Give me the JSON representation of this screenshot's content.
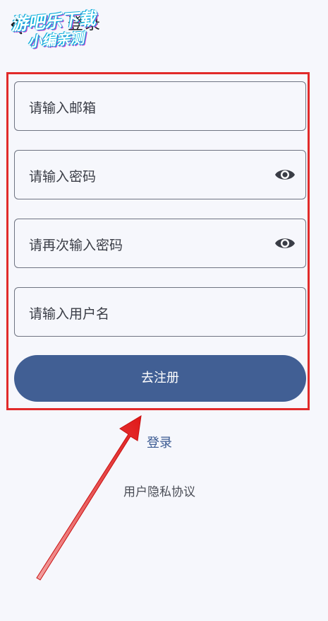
{
  "header": {
    "title": "登录",
    "back_icon": "chevron-left-icon"
  },
  "watermark": {
    "line1": "游吧乐下载",
    "line2": "小编亲测"
  },
  "form": {
    "email_placeholder": "请输入邮箱",
    "password_placeholder": "请输入密码",
    "confirm_placeholder": "请再次输入密码",
    "username_placeholder": "请输入用户名",
    "submit_label": "去注册",
    "password_visibility_icon": "eye-icon"
  },
  "links": {
    "login": "登录",
    "privacy": "用户隐私协议"
  },
  "colors": {
    "background": "#f6f7fc",
    "primary": "#415f94",
    "link": "#3b5a92",
    "highlight": "#e12a2a"
  }
}
